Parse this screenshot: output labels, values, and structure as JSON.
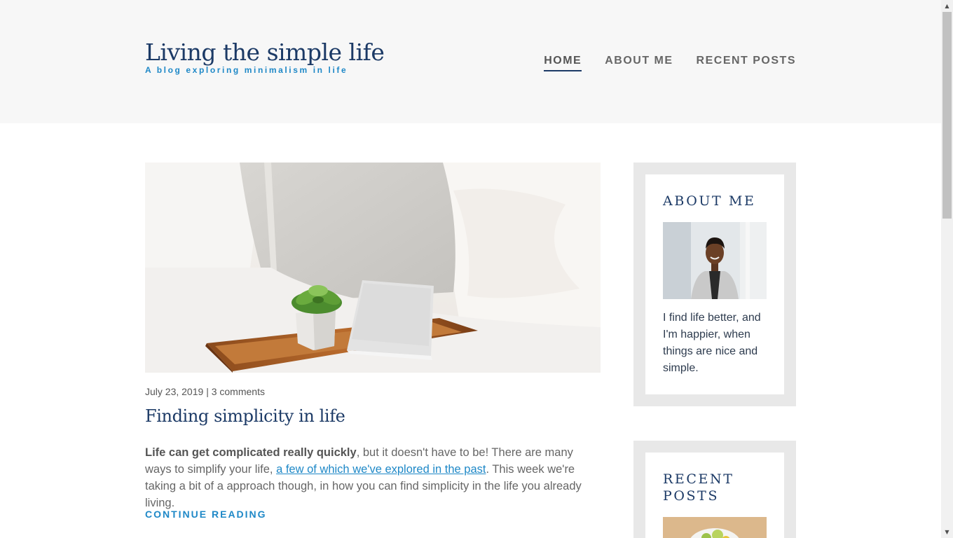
{
  "header": {
    "title": "Living the simple life",
    "tagline": "A blog exploring minimalism in life",
    "nav": [
      {
        "label": "HOME",
        "active": true
      },
      {
        "label": "ABOUT ME",
        "active": false
      },
      {
        "label": "RECENT POSTS",
        "active": false
      }
    ]
  },
  "post": {
    "date": "July 23, 2019",
    "separator": "|",
    "comments": "3 comments",
    "title": "Finding simplicity in life",
    "excerpt_bold": "Life can get complicated really quickly",
    "excerpt_part1": ", but it doesn't have to be! There are many ways to simplify your life, ",
    "excerpt_link": "a few of which we've explored in the past",
    "excerpt_part2": ". This week we're taking a bit of a approach though, in how you can find simplicity in the life you already living.",
    "continue_label": "CONTINUE READING"
  },
  "sidebar": {
    "about": {
      "title": "ABOUT ME",
      "text": "I find life better, and I'm happier, when things are nice and simple."
    },
    "recent": {
      "title_line1": "RECENT",
      "title_line2": "POSTS"
    }
  },
  "colors": {
    "brand_navy": "#1c3a66",
    "accent_blue": "#1e88c7",
    "header_bg": "#f7f7f7",
    "widget_bg": "#e8e8e8"
  }
}
